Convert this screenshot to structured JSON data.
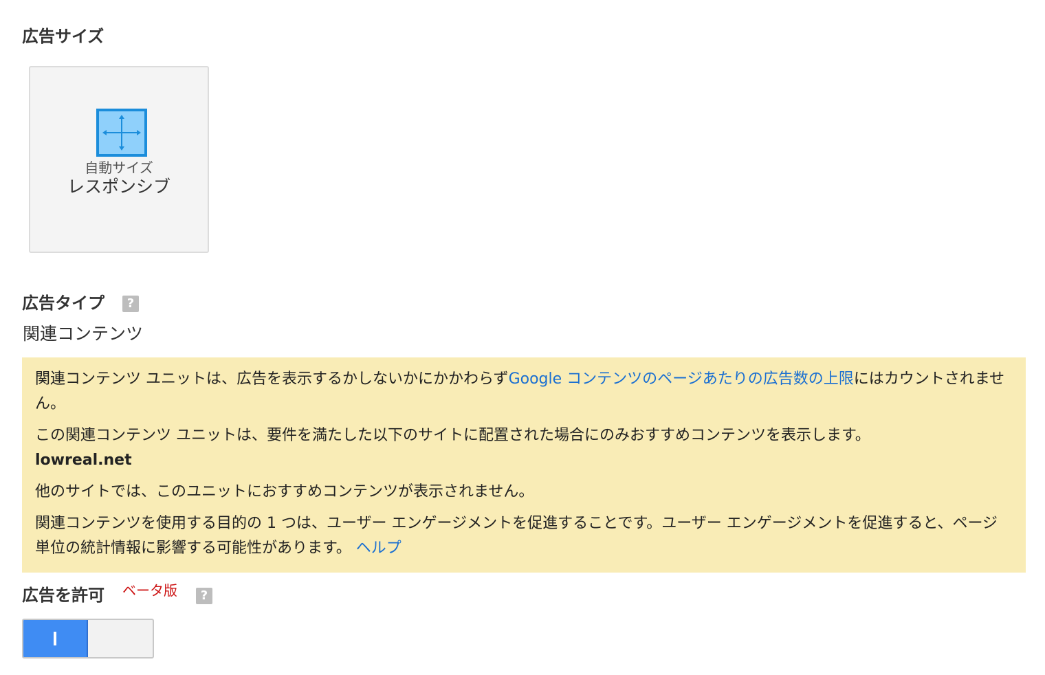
{
  "ad_size": {
    "title": "広告サイズ",
    "card_sub": "自動サイズ",
    "card_main": "レスポンシブ"
  },
  "ad_type": {
    "title": "広告タイプ",
    "help_icon": "?",
    "value": "関連コンテンツ"
  },
  "notice": {
    "p1_prefix": "関連コンテンツ ユニットは、広告を表示するかしないかにかかわらず",
    "p1_link": "Google コンテンツのページあたりの広告数の上限",
    "p1_suffix": "にはカウントされません。",
    "p2": "この関連コンテンツ ユニットは、要件を満たした以下のサイトに配置された場合にのみおすすめコンテンツを表示します。",
    "site": "lowreal.net",
    "p3": "他のサイトでは、このユニットにおすすめコンテンツが表示されません。",
    "p4_text": "関連コンテンツを使用する目的の 1 つは、ユーザー エンゲージメントを促進することです。ユーザー エンゲージメントを促進すると、ページ単位の統計情報に影響する可能性があります。 ",
    "p4_link": "ヘルプ"
  },
  "allow_ads": {
    "title": "広告を許可",
    "beta": "ベータ版",
    "help_icon": "?",
    "toggle_state": "on"
  },
  "colors": {
    "notice_bg": "#f9ecb6",
    "link": "#1a6fd1",
    "toggle_on": "#3f8cf3",
    "beta": "#cc1111",
    "icon_fill": "#8fd0fb",
    "icon_stroke": "#1b8ddb"
  },
  "icons": {
    "resize": "resize-arrows-icon",
    "help": "help-icon"
  }
}
